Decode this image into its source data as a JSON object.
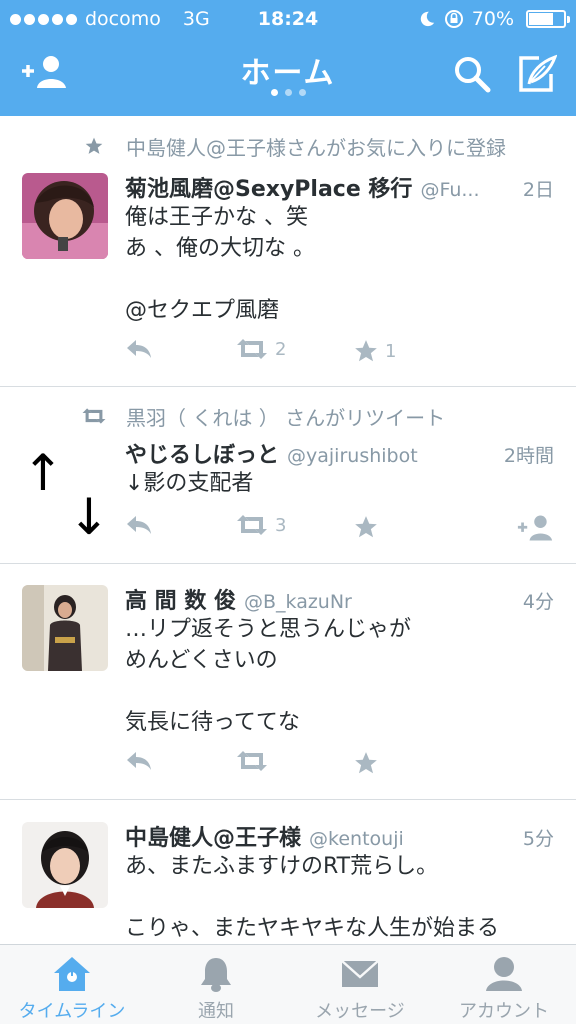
{
  "status_bar": {
    "carrier": "docomo",
    "network": "3G",
    "time": "18:24",
    "battery": "70%",
    "battery_level": 0.7
  },
  "header": {
    "title": "ホーム",
    "page_index": 0,
    "page_count": 3,
    "icons": [
      "add-user-icon",
      "search-icon",
      "compose-icon"
    ]
  },
  "tweets": [
    {
      "context": "中島健人@王子様さんがお気に入りに登録",
      "context_icon": "star-icon",
      "name": "菊池風磨@SexyPlace 移行",
      "handle": "@Fu...",
      "time": "2日",
      "text": "俺は王子かな 、笑\nあ 、俺の大切な 。\n\n@セクエプ風磨",
      "retweets": "2",
      "favorites": "1"
    },
    {
      "context": "黒羽（ くれは ） さんがリツイート",
      "context_icon": "retweet-icon",
      "name": "やじるしぼっと",
      "handle": "@yajirushibot",
      "time": "2時間",
      "text": "↓影の支配者",
      "retweets": "3",
      "favorites": "",
      "avatar_up": "↑",
      "avatar_down": "↓"
    },
    {
      "name": "高 間 数 俊",
      "handle": "@B_kazuNr",
      "time": "4分",
      "text": "…リプ返そうと思うんじゃが\nめんどくさいの\n\n気長に待っててな",
      "retweets": "",
      "favorites": ""
    },
    {
      "name": "中島健人@王子様",
      "handle": "@kentouji",
      "time": "5分",
      "text": "あ、またふますけのRT荒らし。\n\nこりゃ、またヤキヤキな人生が始まる",
      "retweets": "",
      "favorites": ""
    }
  ],
  "tab_bar": {
    "active": "timeline",
    "tabs": [
      {
        "id": "timeline",
        "label": "タイムライン",
        "icon": "home-icon"
      },
      {
        "id": "notifications",
        "label": "通知",
        "icon": "bell-icon"
      },
      {
        "id": "messages",
        "label": "メッセージ",
        "icon": "envelope-icon"
      },
      {
        "id": "account",
        "label": "アカウント",
        "icon": "person-icon"
      }
    ]
  },
  "colors": {
    "brand": "#55acee",
    "muted": "#8899a6",
    "action": "#aab8c2"
  }
}
